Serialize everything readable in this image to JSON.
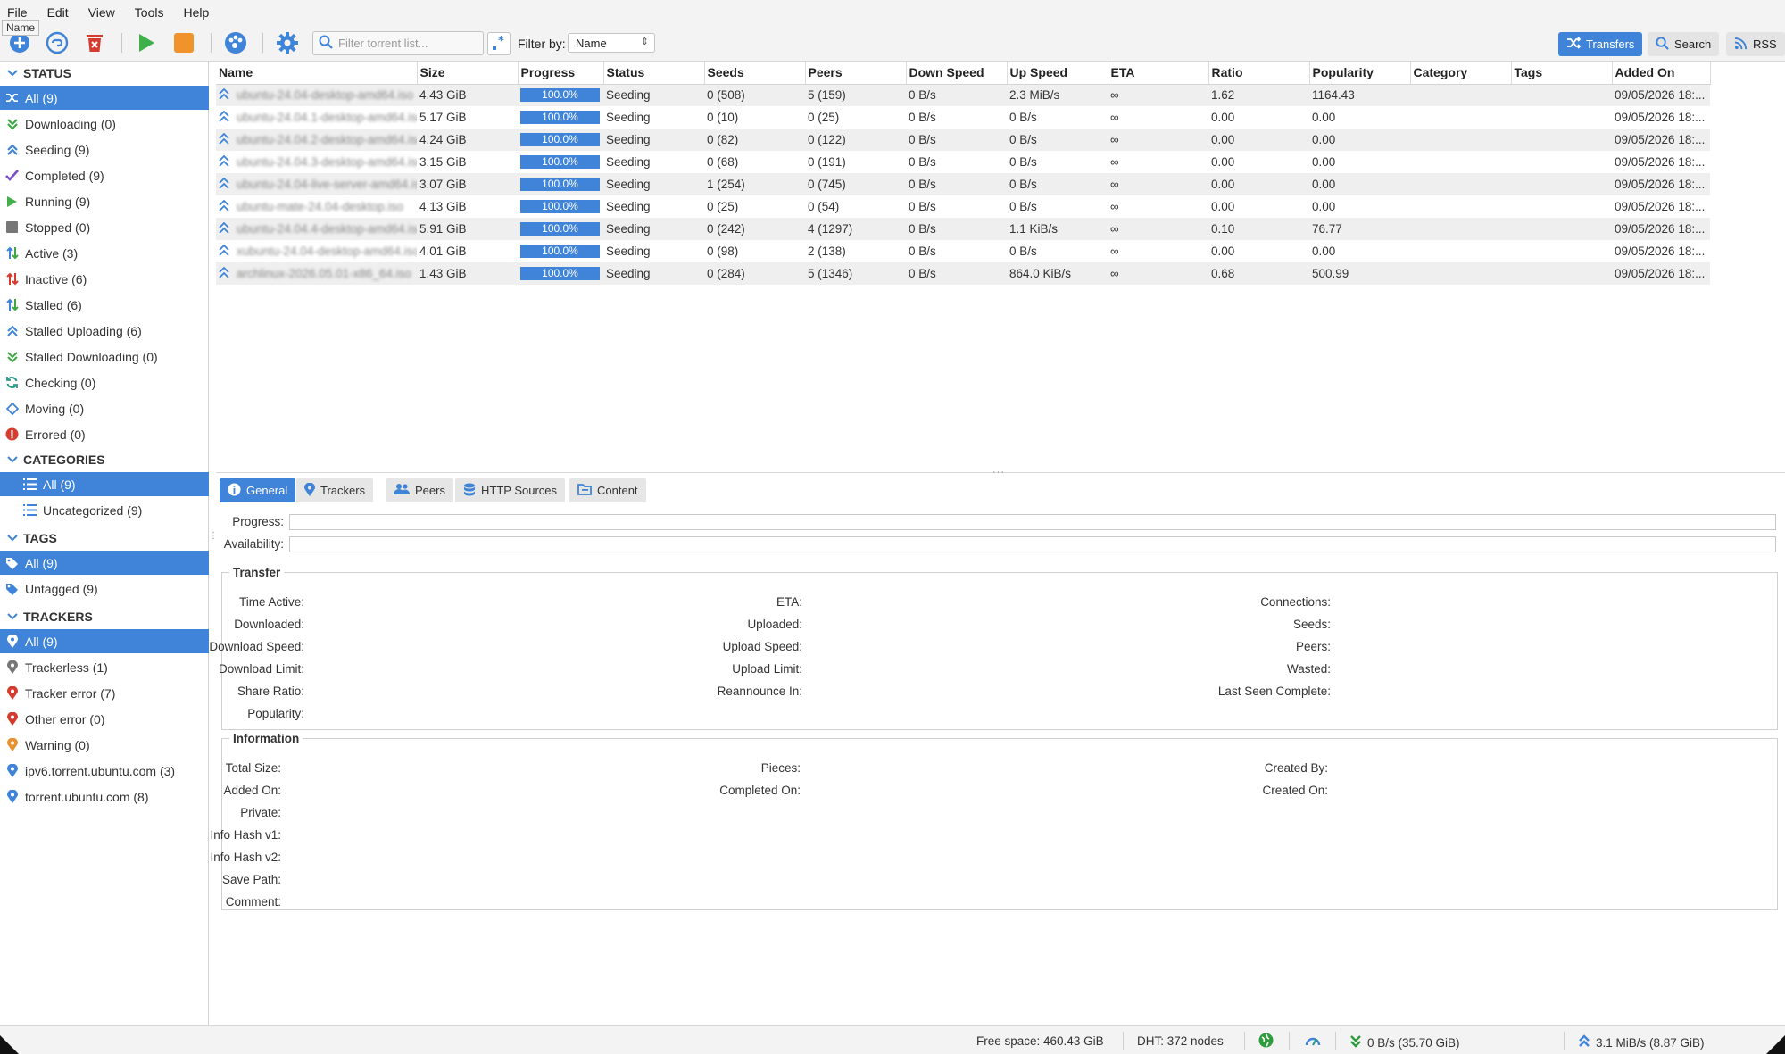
{
  "menu": [
    "File",
    "Edit",
    "View",
    "Tools",
    "Help"
  ],
  "tooltip": "Name",
  "toolbar": {
    "filter_placeholder": "Filter torrent list...",
    "filter_by_label": "Filter by:",
    "filter_by_value": "Name",
    "transfers_label": "Transfers",
    "search_label": "Search",
    "rss_label": "RSS",
    "accent_color": "#3f84d8"
  },
  "sidebar": {
    "status_header": "STATUS",
    "status": [
      {
        "label": "All (9)",
        "icon": "shuffle-icon"
      },
      {
        "label": "Downloading (0)",
        "icon": "download-icon"
      },
      {
        "label": "Seeding (9)",
        "icon": "upload-icon"
      },
      {
        "label": "Completed (9)",
        "icon": "check-icon"
      },
      {
        "label": "Running (9)",
        "icon": "play-icon"
      },
      {
        "label": "Stopped (0)",
        "icon": "stop-icon"
      },
      {
        "label": "Active (3)",
        "icon": "active-arrows-icon"
      },
      {
        "label": "Inactive (6)",
        "icon": "inactive-arrows-icon"
      },
      {
        "label": "Stalled (6)",
        "icon": "stalled-arrows-icon"
      },
      {
        "label": "Stalled Uploading (6)",
        "icon": "stalled-upload-icon"
      },
      {
        "label": "Stalled Downloading (0)",
        "icon": "stalled-download-icon"
      },
      {
        "label": "Checking (0)",
        "icon": "refresh-icon"
      },
      {
        "label": "Moving (0)",
        "icon": "diamond-icon"
      },
      {
        "label": "Errored (0)",
        "icon": "error-icon"
      }
    ],
    "categories_header": "CATEGORIES",
    "categories": [
      {
        "label": "All (9)",
        "icon": "list-icon"
      },
      {
        "label": "Uncategorized (9)",
        "icon": "list-icon"
      }
    ],
    "tags_header": "TAGS",
    "tags": [
      {
        "label": "All (9)",
        "icon": "tag-icon"
      },
      {
        "label": "Untagged (9)",
        "icon": "tag-icon"
      }
    ],
    "trackers_header": "TRACKERS",
    "trackers": [
      {
        "label": "All (9)",
        "icon": "pin-icon",
        "color": "#ffffff"
      },
      {
        "label": "Trackerless (1)",
        "icon": "pin-icon",
        "color": "#777777"
      },
      {
        "label": "Tracker error (7)",
        "icon": "pin-icon",
        "color": "#d63b2f"
      },
      {
        "label": "Other error (0)",
        "icon": "pin-icon",
        "color": "#d63b2f"
      },
      {
        "label": "Warning (0)",
        "icon": "pin-icon",
        "color": "#e8922f"
      },
      {
        "label": "ipv6.torrent.ubuntu.com (3)",
        "icon": "pin-icon",
        "color": "#3f84d8"
      },
      {
        "label": "torrent.ubuntu.com (8)",
        "icon": "pin-icon",
        "color": "#3f84d8"
      }
    ]
  },
  "table": {
    "columns": [
      "Name",
      "Size",
      "Progress",
      "Status",
      "Seeds",
      "Peers",
      "Down Speed",
      "Up Speed",
      "ETA",
      "Ratio",
      "Popularity",
      "Category",
      "Tags",
      "Added On"
    ],
    "rows": [
      {
        "name": "ubuntu-24.04-desktop-amd64.iso",
        "size": "4.43 GiB",
        "progress": "100.0%",
        "status": "Seeding",
        "seeds": "0 (508)",
        "peers": "5 (159)",
        "down": "0 B/s",
        "up": "2.3 MiB/s",
        "eta": "∞",
        "ratio": "1.62",
        "popularity": "1164.43",
        "category": "",
        "tags": "",
        "added": "09/05/2026 18:..."
      },
      {
        "name": "ubuntu-24.04.1-desktop-amd64.iso",
        "size": "5.17 GiB",
        "progress": "100.0%",
        "status": "Seeding",
        "seeds": "0 (10)",
        "peers": "0 (25)",
        "down": "0 B/s",
        "up": "0 B/s",
        "eta": "∞",
        "ratio": "0.00",
        "popularity": "0.00",
        "category": "",
        "tags": "",
        "added": "09/05/2026 18:..."
      },
      {
        "name": "ubuntu-24.04.2-desktop-amd64.iso",
        "size": "4.24 GiB",
        "progress": "100.0%",
        "status": "Seeding",
        "seeds": "0 (82)",
        "peers": "0 (122)",
        "down": "0 B/s",
        "up": "0 B/s",
        "eta": "∞",
        "ratio": "0.00",
        "popularity": "0.00",
        "category": "",
        "tags": "",
        "added": "09/05/2026 18:..."
      },
      {
        "name": "ubuntu-24.04.3-desktop-amd64.iso",
        "size": "3.15 GiB",
        "progress": "100.0%",
        "status": "Seeding",
        "seeds": "0 (68)",
        "peers": "0 (191)",
        "down": "0 B/s",
        "up": "0 B/s",
        "eta": "∞",
        "ratio": "0.00",
        "popularity": "0.00",
        "category": "",
        "tags": "",
        "added": "09/05/2026 18:..."
      },
      {
        "name": "ubuntu-24.04-live-server-amd64.iso",
        "size": "3.07 GiB",
        "progress": "100.0%",
        "status": "Seeding",
        "seeds": "1 (254)",
        "peers": "0 (745)",
        "down": "0 B/s",
        "up": "0 B/s",
        "eta": "∞",
        "ratio": "0.00",
        "popularity": "0.00",
        "category": "",
        "tags": "",
        "added": "09/05/2026 18:..."
      },
      {
        "name": "ubuntu-mate-24.04-desktop.iso",
        "size": "4.13 GiB",
        "progress": "100.0%",
        "status": "Seeding",
        "seeds": "0 (25)",
        "peers": "0 (54)",
        "down": "0 B/s",
        "up": "0 B/s",
        "eta": "∞",
        "ratio": "0.00",
        "popularity": "0.00",
        "category": "",
        "tags": "",
        "added": "09/05/2026 18:..."
      },
      {
        "name": "ubuntu-24.04.4-desktop-amd64.iso",
        "size": "5.91 GiB",
        "progress": "100.0%",
        "status": "Seeding",
        "seeds": "0 (242)",
        "peers": "4 (1297)",
        "down": "0 B/s",
        "up": "1.1 KiB/s",
        "eta": "∞",
        "ratio": "0.10",
        "popularity": "76.77",
        "category": "",
        "tags": "",
        "added": "09/05/2026 18:..."
      },
      {
        "name": "xubuntu-24.04-desktop-amd64.iso",
        "size": "4.01 GiB",
        "progress": "100.0%",
        "status": "Seeding",
        "seeds": "0 (98)",
        "peers": "2 (138)",
        "down": "0 B/s",
        "up": "0 B/s",
        "eta": "∞",
        "ratio": "0.00",
        "popularity": "0.00",
        "category": "",
        "tags": "",
        "added": "09/05/2026 18:..."
      },
      {
        "name": "archlinux-2026.05.01-x86_64.iso",
        "size": "1.43 GiB",
        "progress": "100.0%",
        "status": "Seeding",
        "seeds": "0 (284)",
        "peers": "5 (1346)",
        "down": "0 B/s",
        "up": "864.0 KiB/s",
        "eta": "∞",
        "ratio": "0.68",
        "popularity": "500.99",
        "category": "",
        "tags": "",
        "added": "09/05/2026 18:..."
      }
    ]
  },
  "details": {
    "tabs": [
      "General",
      "Trackers",
      "Peers",
      "HTTP Sources",
      "Content"
    ],
    "progress_label": "Progress:",
    "availability_label": "Availability:",
    "transfer_legend": "Transfer",
    "transfer_col1": [
      "Time Active:",
      "Downloaded:",
      "Download Speed:",
      "Download Limit:",
      "Share Ratio:",
      "Popularity:"
    ],
    "transfer_col2": [
      "ETA:",
      "Uploaded:",
      "Upload Speed:",
      "Upload Limit:",
      "Reannounce In:"
    ],
    "transfer_col3": [
      "Connections:",
      "Seeds:",
      "Peers:",
      "Wasted:",
      "Last Seen Complete:"
    ],
    "info_legend": "Information",
    "info_col1": [
      "Total Size:",
      "Added On:",
      "Private:",
      "Info Hash v1:",
      "Info Hash v2:",
      "Save Path:",
      "Comment:"
    ],
    "info_col2": [
      "Pieces:",
      "Completed On:"
    ],
    "info_col3": [
      "Created By:",
      "Created On:"
    ]
  },
  "statusbar": {
    "free_space": "Free space: 460.43 GiB",
    "dht": "DHT: 372 nodes",
    "download": "0 B/s (35.70 GiB)",
    "upload": "3.1 MiB/s (8.87 GiB)"
  }
}
